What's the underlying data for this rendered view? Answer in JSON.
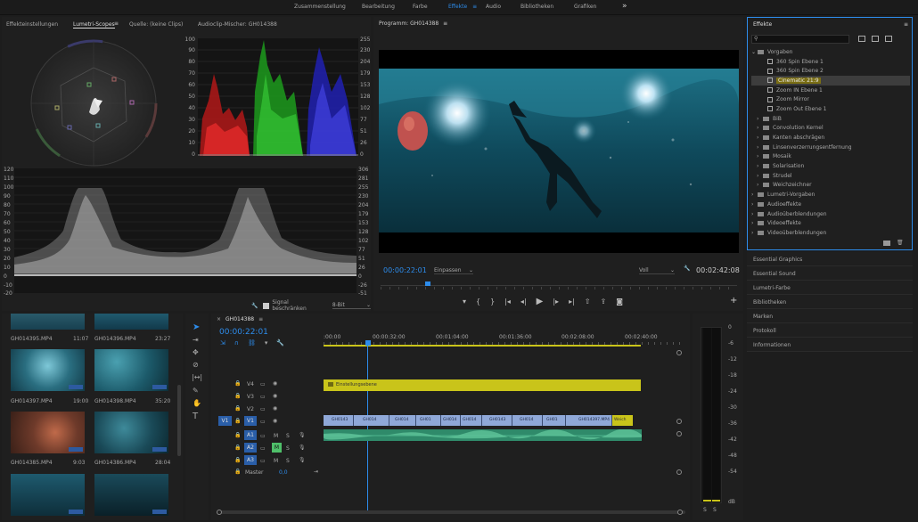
{
  "workspaces": {
    "items": [
      "Zusammenstellung",
      "Bearbeitung",
      "Farbe",
      "Effekte",
      "Audio",
      "Bibliotheken",
      "Grafiken"
    ],
    "active": "Effekte",
    "more": "»"
  },
  "scopes_panel": {
    "tabs": [
      "Effekteinstellungen",
      "Lumetri-Scopes",
      "Quelle: (keine Clips)",
      "Audioclip-Mischer: GH014388"
    ],
    "active_tab": "Lumetri-Scopes",
    "parade_left_ticks": [
      "100",
      "90",
      "80",
      "70",
      "60",
      "50",
      "40",
      "30",
      "20",
      "10",
      "0"
    ],
    "parade_right_ticks": [
      "255",
      "230",
      "204",
      "179",
      "153",
      "128",
      "102",
      "77",
      "51",
      "26",
      "0"
    ],
    "waveform_left_ticks": [
      "120",
      "110",
      "100",
      "90",
      "80",
      "70",
      "60",
      "50",
      "40",
      "30",
      "20",
      "10",
      "0",
      "-10",
      "-20"
    ],
    "waveform_right_ticks": [
      "306",
      "281",
      "255",
      "230",
      "204",
      "179",
      "153",
      "128",
      "102",
      "77",
      "51",
      "26",
      "0",
      "-26",
      "-51"
    ],
    "clamp_label": "Signal beschränken",
    "bit_depth": "8-Bit"
  },
  "program_monitor": {
    "title": "Programm: GH014388",
    "timecode": "00:00:22:01",
    "fit": "Einpassen",
    "quality": "Voll",
    "duration": "00:02:42:08"
  },
  "effects_panel": {
    "title": "Effekte",
    "search_placeholder": "",
    "tree": [
      {
        "label": "Vorgaben",
        "level": 0,
        "type": "folder",
        "open": true
      },
      {
        "label": "360 Spin Ebene 1",
        "level": 1,
        "type": "preset"
      },
      {
        "label": "360 Spin Ebene 2",
        "level": 1,
        "type": "preset"
      },
      {
        "label": "Cinematic 21:9",
        "level": 1,
        "type": "preset",
        "selected": true
      },
      {
        "label": "Zoom IN Ebene 1",
        "level": 1,
        "type": "preset"
      },
      {
        "label": "Zoom Mirror",
        "level": 1,
        "type": "preset"
      },
      {
        "label": "Zoom Out Ebene 1",
        "level": 1,
        "type": "preset"
      },
      {
        "label": "BiB",
        "level": 1,
        "type": "folder"
      },
      {
        "label": "Convolution Kernel",
        "level": 1,
        "type": "folder"
      },
      {
        "label": "Kanten abschrägen",
        "level": 1,
        "type": "folder"
      },
      {
        "label": "Linsenverzerrungsentfernung",
        "level": 1,
        "type": "folder"
      },
      {
        "label": "Mosaik",
        "level": 1,
        "type": "folder"
      },
      {
        "label": "Solarisation",
        "level": 1,
        "type": "folder"
      },
      {
        "label": "Strudel",
        "level": 1,
        "type": "folder"
      },
      {
        "label": "Weichzeichner",
        "level": 1,
        "type": "folder"
      },
      {
        "label": "Lumetri-Vorgaben",
        "level": 0,
        "type": "folder"
      },
      {
        "label": "Audioeffekte",
        "level": 0,
        "type": "folder"
      },
      {
        "label": "Audioüberblendungen",
        "level": 0,
        "type": "folder"
      },
      {
        "label": "Videoeffekte",
        "level": 0,
        "type": "folder"
      },
      {
        "label": "Videoüberblendungen",
        "level": 0,
        "type": "folder"
      }
    ],
    "collapsed_panels": [
      "Essential Graphics",
      "Essential Sound",
      "Lumetri-Farbe",
      "Bibliotheken",
      "Marken",
      "Protokoll",
      "Informationen"
    ]
  },
  "project_bin": {
    "clips": [
      {
        "name": "GH014395.MP4",
        "duration": "11:07"
      },
      {
        "name": "GH014396.MP4",
        "duration": "23:27"
      },
      {
        "name": "GH014397.MP4",
        "duration": "19:00"
      },
      {
        "name": "GH014398.MP4",
        "duration": "35:20"
      },
      {
        "name": "GH014385.MP4",
        "duration": "9:03"
      },
      {
        "name": "GH014386.MP4",
        "duration": "28:04"
      },
      {
        "name": "",
        "duration": ""
      },
      {
        "name": "",
        "duration": ""
      }
    ]
  },
  "timeline": {
    "sequence_name": "GH014388",
    "timecode": "00:00:22:01",
    "ruler": [
      ":00:00",
      "00:00:32:00",
      "00:01:04:00",
      "00:01:36:00",
      "00:02:08:00",
      "00:02:40:00"
    ],
    "video_tracks": [
      "V4",
      "V3",
      "V2",
      "V1"
    ],
    "audio_tracks": [
      "A1",
      "A2",
      "A3"
    ],
    "source_patch_video": "V1",
    "master_label": "Master",
    "master_value": "0,0",
    "adjustment_layer_label": "Einstellungsebene",
    "v1_clips": [
      "GH0143",
      "GH014",
      "GH014",
      "GH01",
      "GH014",
      "GH014",
      "GH0143",
      "GH014",
      "GH01",
      "GH014397.MP4",
      "Weich"
    ],
    "mute_label": "M",
    "solo_label": "S"
  },
  "audio_meter": {
    "ticks": [
      "0",
      "-6",
      "-12",
      "-18",
      "-24",
      "-30",
      "-36",
      "-42",
      "-48",
      "-54",
      "dB"
    ],
    "channel_labels": [
      "S",
      "S"
    ]
  },
  "tools": [
    "selection",
    "track-select",
    "ripple",
    "razor",
    "slip",
    "pen",
    "hand",
    "type"
  ]
}
